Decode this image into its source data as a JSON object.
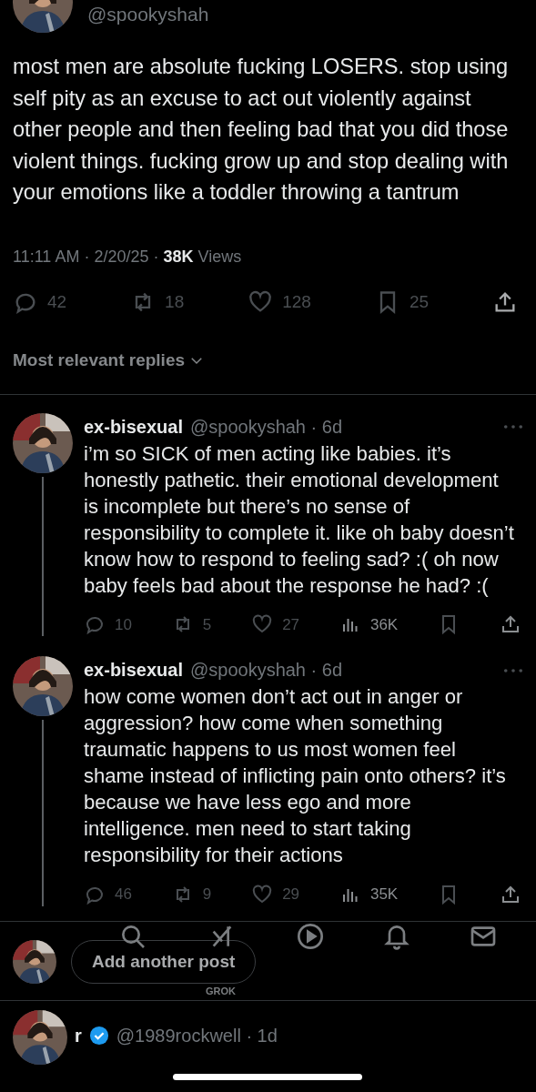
{
  "post": {
    "handle": "@spookyshah",
    "text": "most men are absolute fucking LOSERS. stop using self pity as an excuse to act out violently against other people and then feeling bad that you did those violent things. fucking grow up and stop dealing with your emotions like a toddler throwing a tantrum",
    "time": "11:11 AM ·",
    "date": "2/20/25 ·",
    "views_count": "38K",
    "views_label": "Views",
    "actions": [
      {
        "kind": "reply",
        "count": "42"
      },
      {
        "kind": "repost",
        "count": "18"
      },
      {
        "kind": "like",
        "count": "128"
      },
      {
        "kind": "bookmark",
        "count": "25"
      },
      {
        "kind": "share"
      }
    ]
  },
  "replies_sort": "Most relevant replies",
  "replies": [
    {
      "name": "ex-bisexual",
      "handle": "@spookyshah",
      "age": "· 6d",
      "text": "i’m so SICK of men acting like babies. it’s honestly pathetic. their emotional development is incomplete but there’s no sense of responsibility to complete it. like oh baby doesn’t know how to respond to feeling sad? :( oh now baby feels bad about the response he had? :(",
      "actions": [
        {
          "kind": "reply",
          "count": "10"
        },
        {
          "kind": "repost",
          "count": "5"
        },
        {
          "kind": "like",
          "count": "27"
        },
        {
          "kind": "views",
          "count": "36K"
        },
        {
          "kind": "bookmark"
        },
        {
          "kind": "share"
        }
      ]
    },
    {
      "name": "ex-bisexual",
      "handle": "@spookyshah",
      "age": "· 6d",
      "text": "how come women don’t act out in anger or aggression? how come when something traumatic happens to us most women feel shame instead of inflicting pain onto others? it’s because we have less ego and more intelligence. men need to start taking responsibility for their actions",
      "actions": [
        {
          "kind": "reply",
          "count": "46"
        },
        {
          "kind": "repost",
          "count": "9"
        },
        {
          "kind": "like",
          "count": "29"
        },
        {
          "kind": "views",
          "count": "35K"
        },
        {
          "kind": "bookmark"
        },
        {
          "kind": "share"
        }
      ]
    }
  ],
  "composer": {
    "label": "Add another post"
  },
  "tab_bar": [
    {
      "kind": "search"
    },
    {
      "kind": "grok",
      "label": "GROK"
    },
    {
      "kind": "video"
    },
    {
      "kind": "notifications"
    },
    {
      "kind": "messages"
    }
  ],
  "next_reply": {
    "name": "r",
    "verified": true,
    "handle": "@1989rockwell",
    "age": "· 1d"
  }
}
